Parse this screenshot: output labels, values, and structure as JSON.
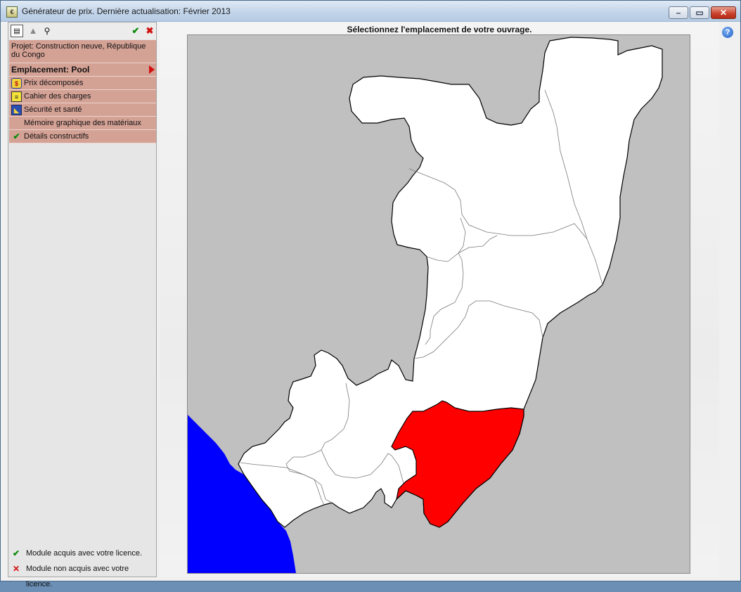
{
  "window": {
    "title": "Générateur de prix. Dernière actualisation: Février 2013",
    "app_icon": "price-generator-icon",
    "controls": {
      "minimize": "minimize-icon",
      "maximize": "maximize-icon",
      "close": "close-icon"
    }
  },
  "toolbar": {
    "report_icon": "report-icon",
    "up_icon": "up-arrow-icon",
    "find_icon": "binoculars-icon",
    "accept_icon": "check-icon",
    "cancel_icon": "cross-icon"
  },
  "menu": {
    "project": "Projet: Construction neuve, République du Congo",
    "location": "Emplacement: Pool",
    "items": [
      {
        "label": "Prix décomposés",
        "icon": "price-breakdown-icon"
      },
      {
        "label": "Cahier des charges",
        "icon": "specifications-icon"
      },
      {
        "label": "Sécurité et santé",
        "icon": "safety-health-icon"
      },
      {
        "label": "Mémoire graphique des matériaux",
        "icon": ""
      },
      {
        "label": "Détails constructifs",
        "icon": "check-icon"
      }
    ]
  },
  "legend": {
    "acquired": "Module acquis avec votre licence.",
    "not_acquired": "Module non acquis avec votre licence."
  },
  "map": {
    "instruction": "Sélectionnez l'emplacement de votre ouvrage.",
    "selected_region": "Pool",
    "colors": {
      "background": "#c0c0c0",
      "land": "#ffffff",
      "selected": "#ff0000",
      "ocean": "#0000ff",
      "border": "#000000",
      "internal_border": "#7a7a7a"
    }
  },
  "help": {
    "icon": "help-icon"
  }
}
